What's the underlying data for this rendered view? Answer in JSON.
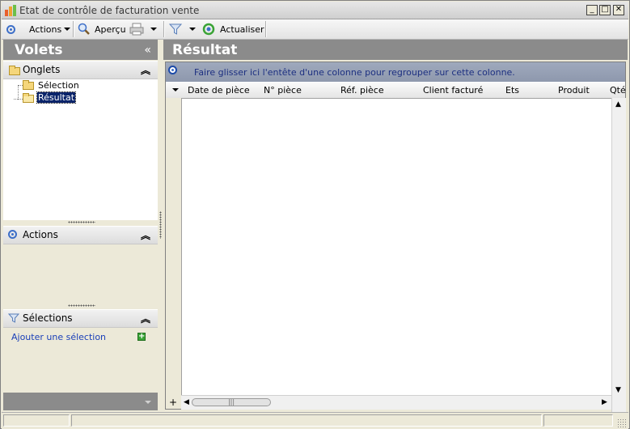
{
  "window": {
    "title": "Etat de contrôle de facturation vente",
    "minimize": "_",
    "maximize": "□",
    "close": "✕"
  },
  "toolbar": {
    "actions_label": "Actions",
    "apercu_label": "Aperçu",
    "actualiser_label": "Actualiser",
    "icons": [
      "actions-icon",
      "magnifier-icon",
      "printer-icon",
      "filter-icon",
      "refresh-icon"
    ]
  },
  "left_panel": {
    "title": "Volets",
    "collapse_glyph": "«",
    "onglets": {
      "label": "Onglets",
      "items": [
        {
          "label": "Sélection"
        },
        {
          "label": "Résultat",
          "selected": true
        }
      ]
    },
    "actions": {
      "label": "Actions"
    },
    "selections": {
      "label": "Sélections",
      "add_link": "Ajouter une sélection"
    }
  },
  "right_panel": {
    "title": "Résultat",
    "group_hint": "Faire glisser ici l'entête d'une colonne pour regrouper sur cette colonne.",
    "columns": [
      "Date de pièce",
      "N° pièce",
      "Réf. pièce",
      "Client facturé",
      "Ets",
      "Produit",
      "Qté"
    ],
    "new_row_glyph": "+"
  },
  "colors": {
    "header_gray": "#8b8b8b",
    "link_blue": "#1a3fb8",
    "group_text": "#1c2f80",
    "accent_blue": "#3d6fc8",
    "plus_green": "#3aa336"
  }
}
